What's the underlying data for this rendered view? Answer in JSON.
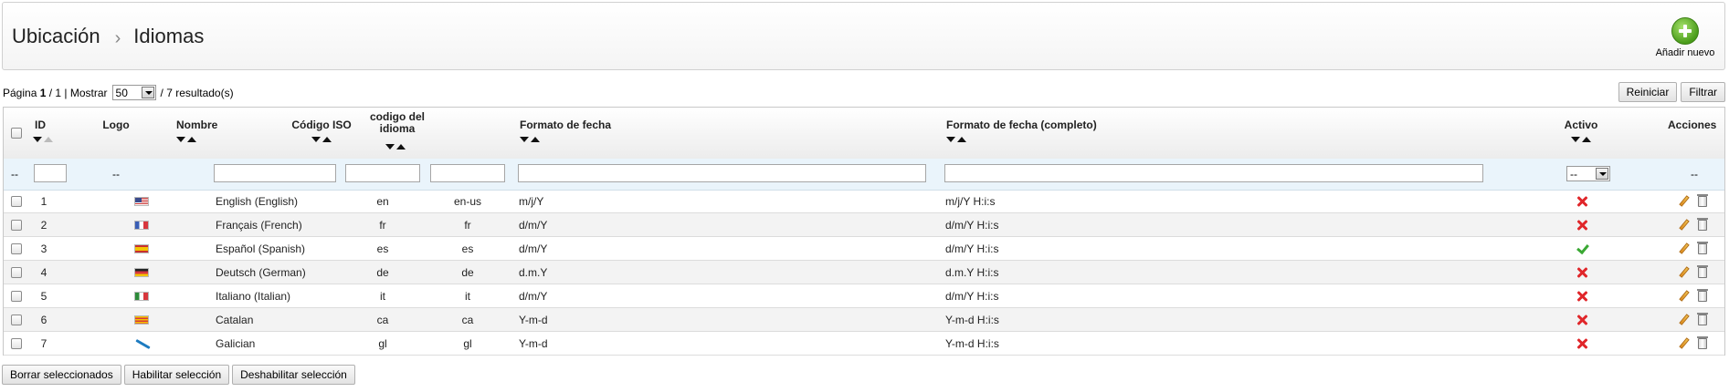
{
  "header": {
    "breadcrumb": [
      "Ubicación",
      "Idiomas"
    ],
    "separator": "›",
    "add_new_label": "Añadir nuevo",
    "add_new_icon": "add-circle-icon"
  },
  "pager": {
    "page_label": "Página",
    "current_page": "1",
    "page_total": "/ 1 | Mostrar",
    "per_page": "50",
    "results": "/ 7 resultado(s)"
  },
  "toolbar": {
    "reset_label": "Reiniciar",
    "filter_label": "Filtrar"
  },
  "columns": {
    "id": "ID",
    "logo": "Logo",
    "name": "Nombre",
    "iso": "Código ISO",
    "lang_code": "codigo del idioma",
    "date_format": "Formato de fecha",
    "date_format_full": "Formato de fecha (completo)",
    "active": "Activo",
    "actions": "Acciones"
  },
  "filter": {
    "placeholder_dash": "--",
    "active_select": "--"
  },
  "rows": [
    {
      "id": "1",
      "flag": "us-flag-icon",
      "name": "English (English)",
      "iso": "en",
      "code": "en-us",
      "date": "m/j/Y",
      "date_full": "m/j/Y H:i:s",
      "active": false
    },
    {
      "id": "2",
      "flag": "fr-flag-icon",
      "name": "Français (French)",
      "iso": "fr",
      "code": "fr",
      "date": "d/m/Y",
      "date_full": "d/m/Y H:i:s",
      "active": false
    },
    {
      "id": "3",
      "flag": "es-flag-icon",
      "name": "Español (Spanish)",
      "iso": "es",
      "code": "es",
      "date": "d/m/Y",
      "date_full": "d/m/Y H:i:s",
      "active": true
    },
    {
      "id": "4",
      "flag": "de-flag-icon",
      "name": "Deutsch (German)",
      "iso": "de",
      "code": "de",
      "date": "d.m.Y",
      "date_full": "d.m.Y H:i:s",
      "active": false
    },
    {
      "id": "5",
      "flag": "it-flag-icon",
      "name": "Italiano (Italian)",
      "iso": "it",
      "code": "it",
      "date": "d/m/Y",
      "date_full": "d/m/Y H:i:s",
      "active": false
    },
    {
      "id": "6",
      "flag": "ca-flag-icon",
      "name": "Catalan",
      "iso": "ca",
      "code": "ca",
      "date": "Y-m-d",
      "date_full": "Y-m-d H:i:s",
      "active": false
    },
    {
      "id": "7",
      "flag": "gl-flag-icon",
      "name": "Galician",
      "iso": "gl",
      "code": "gl",
      "date": "Y-m-d",
      "date_full": "Y-m-d H:i:s",
      "active": false
    }
  ],
  "bulk": {
    "delete_label": "Borrar seleccionados",
    "enable_label": "Habilitar selección",
    "disable_label": "Deshabilitar selección"
  },
  "colors": {
    "inactive": "#e0262a",
    "active": "#3aa833",
    "filter_row_bg": "#eaf4fb",
    "alt_row_bg": "#f3f3f3"
  }
}
